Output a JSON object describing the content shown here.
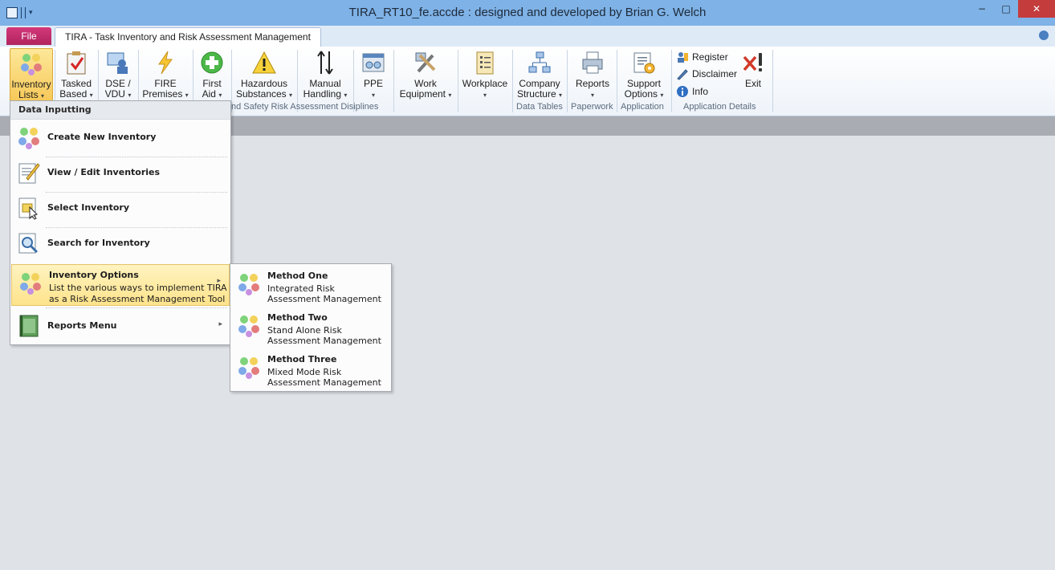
{
  "window": {
    "title": "TIRA_RT10_fe.accde : designed and developed by Brian G. Welch",
    "min": "−",
    "max": "□",
    "close": "✕"
  },
  "tabs": {
    "file": "File",
    "main": "TIRA - Task Inventory and Risk Assessment Management"
  },
  "ribbon": {
    "buttons": [
      {
        "line1": "Inventory",
        "line2": "Lists",
        "caret": "▾"
      },
      {
        "line1": "Tasked",
        "line2": "Based",
        "caret": "▾"
      },
      {
        "line1": "DSE /",
        "line2": "VDU",
        "caret": "▾"
      },
      {
        "line1": "FIRE",
        "line2": "Premises",
        "caret": "▾"
      },
      {
        "line1": "First",
        "line2": "Aid",
        "caret": "▾"
      },
      {
        "line1": "Hazardous",
        "line2": "Substances",
        "caret": "▾"
      },
      {
        "line1": "Manual",
        "line2": "Handling",
        "caret": "▾"
      },
      {
        "line1": "PPE",
        "line2": "",
        "caret": "▾"
      },
      {
        "line1": "Work",
        "line2": "Equipment",
        "caret": "▾"
      },
      {
        "line1": "Workplace",
        "line2": "",
        "caret": "▾"
      },
      {
        "line1": "Company",
        "line2": "Structure",
        "caret": "▾"
      },
      {
        "line1": "Reports",
        "line2": "",
        "caret": "▾"
      },
      {
        "line1": "Support",
        "line2": "Options",
        "caret": "▾"
      },
      {
        "line1": "Exit",
        "line2": "",
        "caret": ""
      }
    ],
    "small": {
      "register": "Register",
      "disclaimer": "Disclaimer",
      "info": "Info"
    },
    "groups": {
      "disciplines": "nd Safety Risk Assessment Disiplines",
      "data_tables": "Data Tables",
      "paperwork": "Paperwork",
      "application": "Application",
      "app_details": "Application Details"
    }
  },
  "menu": {
    "header": "Data Inputting",
    "items": [
      {
        "label": "Create New Inventory"
      },
      {
        "label": "View / Edit Inventories"
      },
      {
        "label": "Select Inventory"
      },
      {
        "label": "Search for Inventory"
      },
      {
        "label": "Inventory Options",
        "desc1": "List the various ways to implement TIRA",
        "desc2": "as a Risk Assessment Management Tool",
        "arrow": "▸"
      },
      {
        "label": "Reports Menu",
        "arrow": "▸"
      }
    ]
  },
  "submenu": {
    "items": [
      {
        "title": "Method One",
        "l1": "Integrated Risk",
        "l2": "Assessment Management"
      },
      {
        "title": "Method Two",
        "l1": "Stand Alone Risk",
        "l2": "Assessment Management"
      },
      {
        "title": "Method Three",
        "l1": "Mixed Mode Risk",
        "l2": "Assessment Management"
      }
    ]
  },
  "colors": {
    "accent_file": "#c62e6e",
    "highlight": "#fde38b",
    "titlebar": "#7fb2e6"
  }
}
